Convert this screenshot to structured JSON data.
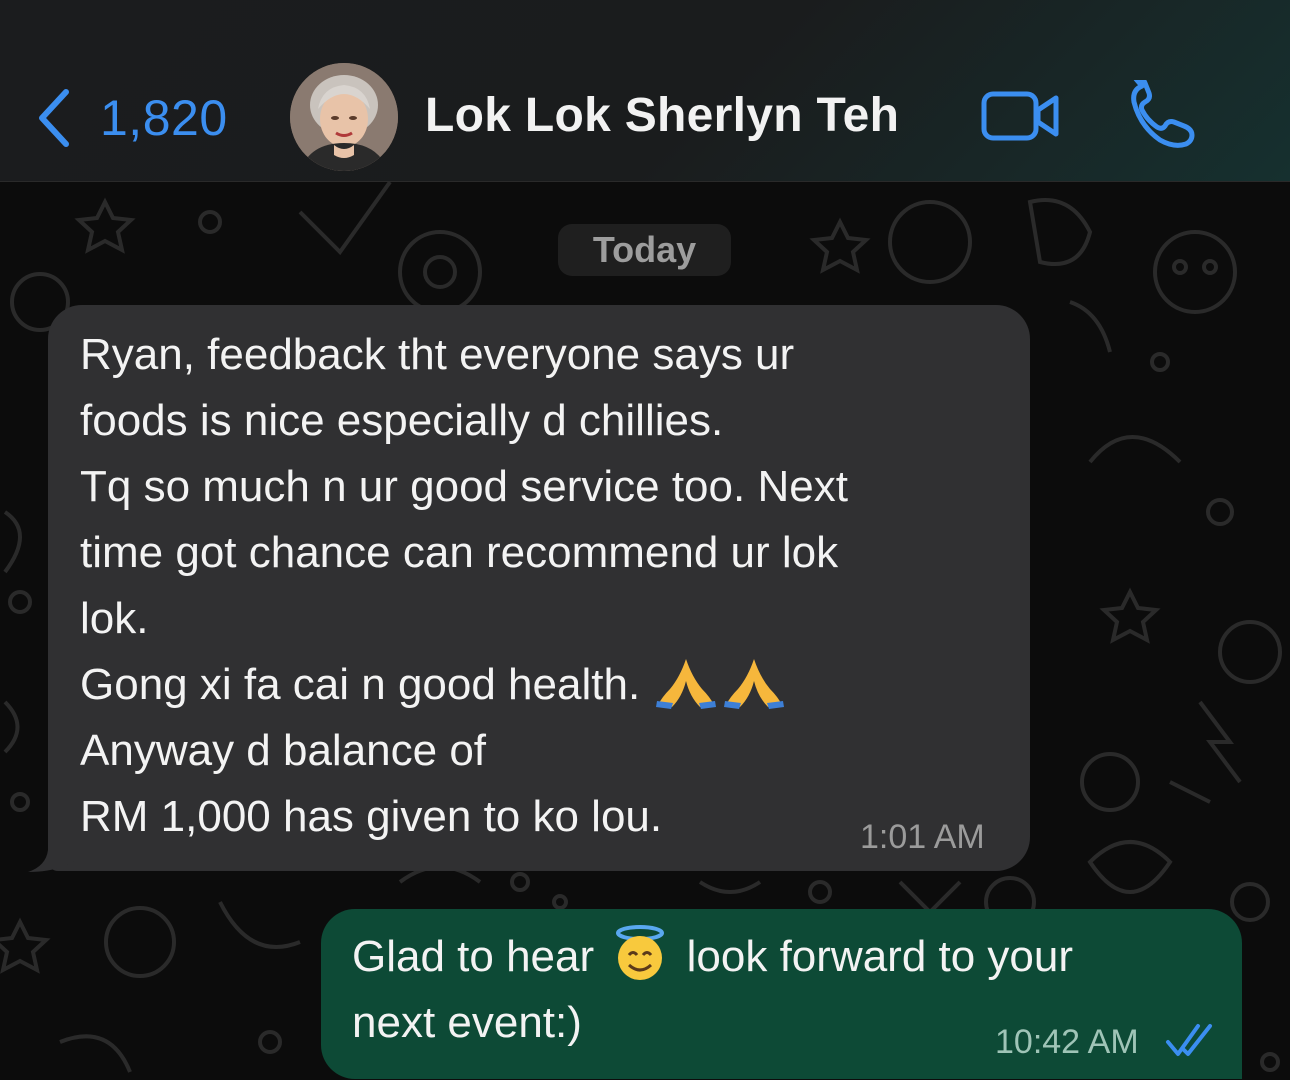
{
  "header": {
    "back_count": "1,820",
    "contact_name": "Lok Lok Sherlyn Teh",
    "back_icon": "chevron-left-icon",
    "video_icon": "video-camera-icon",
    "call_icon": "phone-icon"
  },
  "date_separator": "Today",
  "messages": [
    {
      "direction": "incoming",
      "lines": [
        "Ryan, feedback tht everyone says ur",
        "foods is nice especially d chillies.",
        "Tq so much n ur good service too. Next",
        "time got chance can recommend ur lok",
        "lok.",
        "Gong xi fa cai n good health.",
        "Anyway d balance of",
        "RM 1,000 has given to ko lou."
      ],
      "emoji": [
        "folded-hands-emoji",
        "folded-hands-emoji"
      ],
      "time": "1:01 AM"
    },
    {
      "direction": "outgoing",
      "text_before_emoji": "Glad to hear",
      "emoji": "smiling-face-with-halo-emoji",
      "text_after_emoji": "look forward to your",
      "text_line2": "next event:)",
      "time": "10:42 AM",
      "status_icon": "double-check-read-icon"
    }
  ],
  "colors": {
    "accent": "#3b8ef0",
    "incoming_bubble": "#303032",
    "outgoing_bubble": "#0d4a36",
    "read_ticks": "#3b8ef0"
  }
}
